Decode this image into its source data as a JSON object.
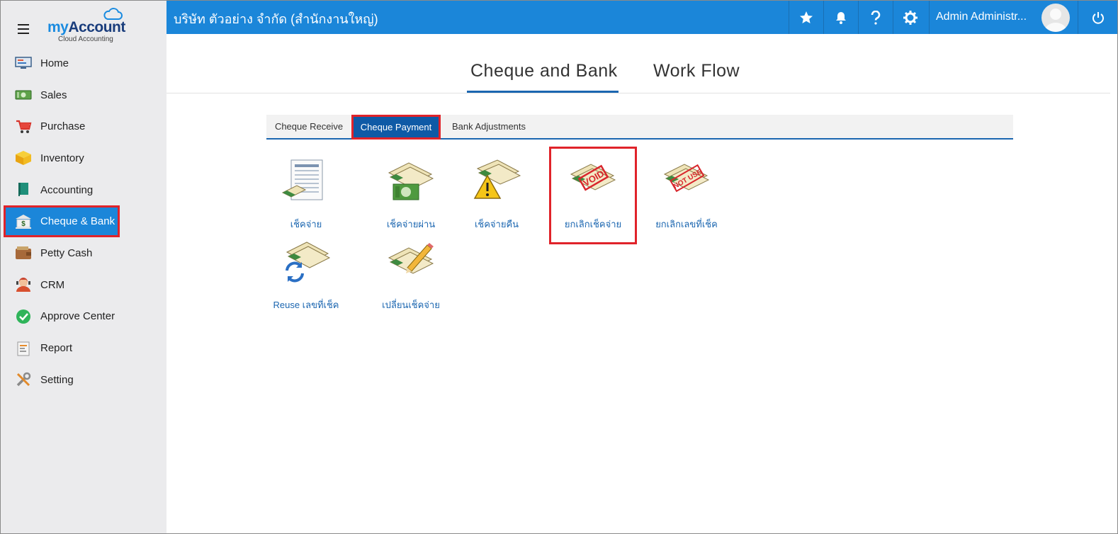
{
  "brand": {
    "name_part1": "my",
    "name_part2": "Account",
    "tagline": "Cloud Accounting"
  },
  "sidebar": {
    "items": [
      {
        "label": "Home",
        "icon": "home-icon"
      },
      {
        "label": "Sales",
        "icon": "sales-icon"
      },
      {
        "label": "Purchase",
        "icon": "cart-icon"
      },
      {
        "label": "Inventory",
        "icon": "box-icon"
      },
      {
        "label": "Accounting",
        "icon": "book-icon"
      },
      {
        "label": "Cheque & Bank",
        "icon": "bank-icon",
        "active": true
      },
      {
        "label": "Petty Cash",
        "icon": "wallet-icon"
      },
      {
        "label": "CRM",
        "icon": "person-icon"
      },
      {
        "label": "Approve Center",
        "icon": "check-circle-icon"
      },
      {
        "label": "Report",
        "icon": "report-icon"
      },
      {
        "label": "Setting",
        "icon": "tools-icon"
      }
    ]
  },
  "header": {
    "company": "บริษัท ตัวอย่าง จำกัด (สำนักงานใหญ่)",
    "user_name": "Admin Administr...",
    "accent": "#1b86d9"
  },
  "page_tabs": [
    {
      "label": "Cheque and Bank",
      "active": true
    },
    {
      "label": "Work Flow",
      "active": false
    }
  ],
  "sub_tabs": [
    {
      "label": "Cheque Receive",
      "active": false
    },
    {
      "label": "Cheque Payment",
      "active": true
    },
    {
      "label": "Bank Adjustments",
      "active": false
    }
  ],
  "tiles": [
    {
      "label": "เช็คจ่าย",
      "icon": "cheque-list-icon"
    },
    {
      "label": "เช็คจ่ายผ่าน",
      "icon": "cheque-cash-icon"
    },
    {
      "label": "เช็คจ่ายคืน",
      "icon": "cheque-warning-icon"
    },
    {
      "label": "ยกเลิกเช็คจ่าย",
      "icon": "cheque-void-icon",
      "stamp": "VOID",
      "highlighted": true
    },
    {
      "label": "ยกเลิกเลขที่เช็ค",
      "icon": "cheque-not-use-icon",
      "stamp": "NOT USE"
    },
    {
      "label": "Reuse เลขที่เช็ค",
      "icon": "cheque-reuse-icon"
    },
    {
      "label": "เปลี่ยนเช็คจ่าย",
      "icon": "cheque-edit-icon"
    }
  ]
}
